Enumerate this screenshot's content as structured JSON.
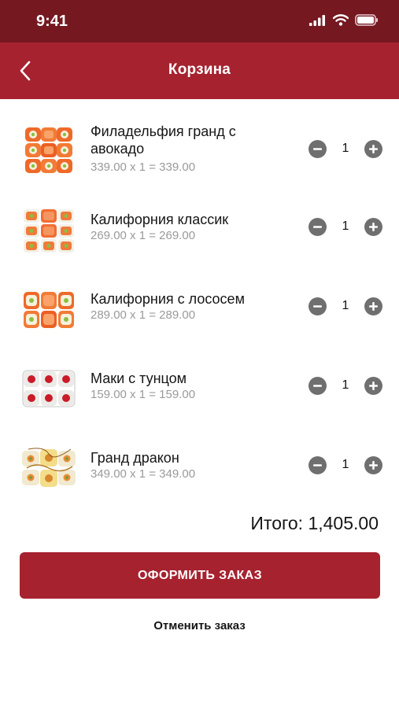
{
  "status_bar": {
    "time": "9:41"
  },
  "header": {
    "title": "Корзина",
    "back_icon": "chevron-left-icon"
  },
  "items": [
    {
      "name": "Филадельфия гранд с авокадо",
      "price_line": "339.00 x 1 = 339.00",
      "quantity": "1"
    },
    {
      "name": "Калифорния классик",
      "price_line": "269.00 x 1 = 269.00",
      "quantity": "1"
    },
    {
      "name": "Калифорния с лососем",
      "price_line": "289.00 x 1 = 289.00",
      "quantity": "1"
    },
    {
      "name": "Маки с тунцом",
      "price_line": "159.00 x 1 = 159.00",
      "quantity": "1"
    },
    {
      "name": "Гранд дракон",
      "price_line": "349.00 x 1 = 349.00",
      "quantity": "1"
    }
  ],
  "summary": {
    "total": "Итого: 1,405.00"
  },
  "actions": {
    "order_label": "ОФОРМИТЬ ЗАКАЗ",
    "cancel_label": "Отменить заказ"
  },
  "colors": {
    "brand": "#a6222f",
    "status_bar": "#751820",
    "qty_button": "#6f6f6f",
    "muted_text": "#9a9a9a"
  }
}
